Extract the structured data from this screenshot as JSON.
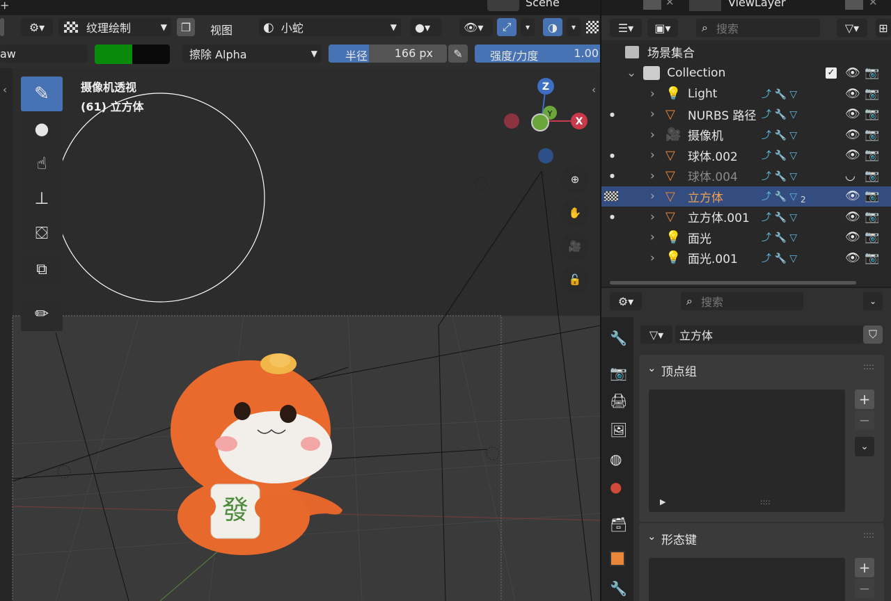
{
  "top_bar": {
    "scene": "Scene",
    "view_layer": "ViewLayer"
  },
  "header": {
    "mode": "纹理绘制",
    "view_menu": "视图",
    "texture_slot": "小蛇",
    "brush_name_partial": "aw",
    "blend_mode": "擦除 Alpha",
    "radius_label": "半径",
    "radius_value": "166 px",
    "strength_label": "强度/力度",
    "strength_value": "1.00"
  },
  "viewport": {
    "camera_label": "摄像机透视",
    "object_label": "(61) 立方体",
    "gizmo": {
      "z": "Z",
      "y": "Y",
      "x": "X"
    },
    "mahjong_char": "發"
  },
  "outliner": {
    "search_placeholder": "搜索",
    "root": "场景集合",
    "collection": "Collection",
    "items": [
      {
        "name": "Light"
      },
      {
        "name": "NURBS 路径"
      },
      {
        "name": "摄像机"
      },
      {
        "name": "球体.002"
      },
      {
        "name": "球体.004"
      },
      {
        "name": "立方体",
        "selected": true,
        "badge": "2"
      },
      {
        "name": "立方体.001"
      },
      {
        "name": "面光"
      },
      {
        "name": "面光.001"
      }
    ]
  },
  "properties": {
    "search_placeholder": "搜索",
    "object_name": "立方体",
    "vertex_groups": "顶点组",
    "shape_keys": "形态键"
  },
  "colors": {
    "accent": "#4772b3",
    "selected_row": "#334d80",
    "object_orange": "#e8873a"
  }
}
